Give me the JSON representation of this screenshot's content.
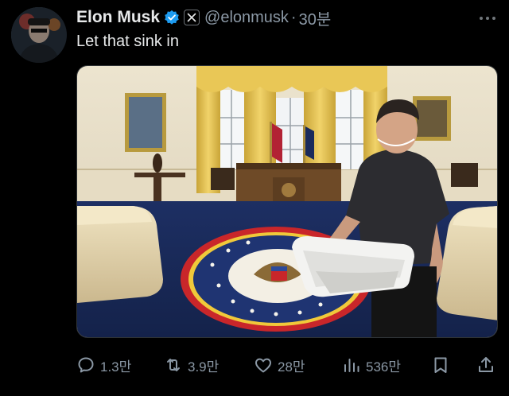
{
  "author": {
    "name": "Elon Musk",
    "handle": "@elonmusk",
    "separator": "·",
    "time": "30분"
  },
  "tweet": {
    "text": "Let that sink in"
  },
  "actions": {
    "reply_count": "1.3만",
    "retweet_count": "3.9만",
    "like_count": "28만",
    "view_count": "536만"
  },
  "icons": {
    "verified": "verified-badge-icon",
    "affiliate": "x-logo-icon",
    "more": "more-icon",
    "reply": "reply-icon",
    "retweet": "retweet-icon",
    "like": "heart-icon",
    "views": "views-icon",
    "bookmark": "bookmark-icon",
    "share": "share-icon"
  },
  "colors": {
    "background": "#000000",
    "primary_text": "#e7e9ea",
    "secondary_text": "#8b98a5",
    "verified_blue": "#1d9bf0"
  }
}
